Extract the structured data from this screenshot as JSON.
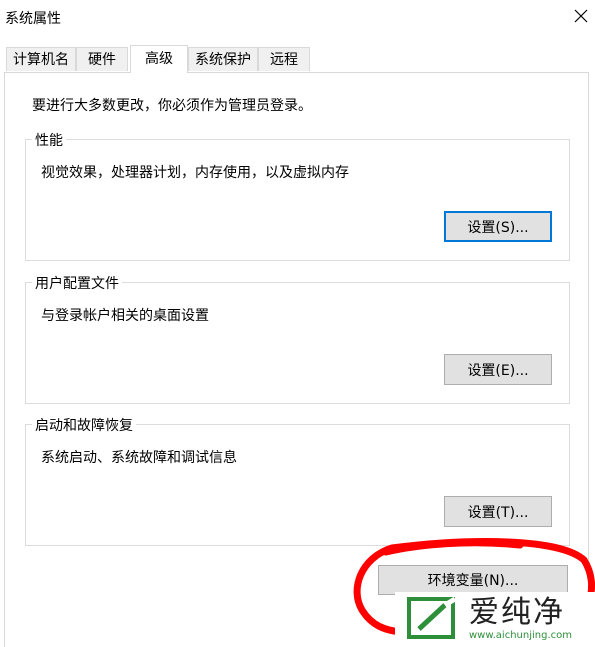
{
  "window": {
    "title": "系统属性"
  },
  "tabs": [
    "计算机名",
    "硬件",
    "高级",
    "系统保护",
    "远程"
  ],
  "intro_text": "要进行大多数更改，你必须作为管理员登录。",
  "performance": {
    "title": "性能",
    "description": "视觉效果，处理器计划，内存使用，以及虚拟内存",
    "button": "设置(S)..."
  },
  "user_profiles": {
    "title": "用户配置文件",
    "description": "与登录帐户相关的桌面设置",
    "button": "设置(E)..."
  },
  "startup_recovery": {
    "title": "启动和故障恢复",
    "description": "系统启动、系统故障和调试信息",
    "button": "设置(T)..."
  },
  "env_button": "环境变量(N)...",
  "watermark": {
    "brand": "爱纯净",
    "url": "www.aichunjing.com"
  },
  "colors": {
    "focus_border": "#0078d7",
    "annotation": "#ff0000",
    "watermark_green": "#2e8f3a"
  }
}
